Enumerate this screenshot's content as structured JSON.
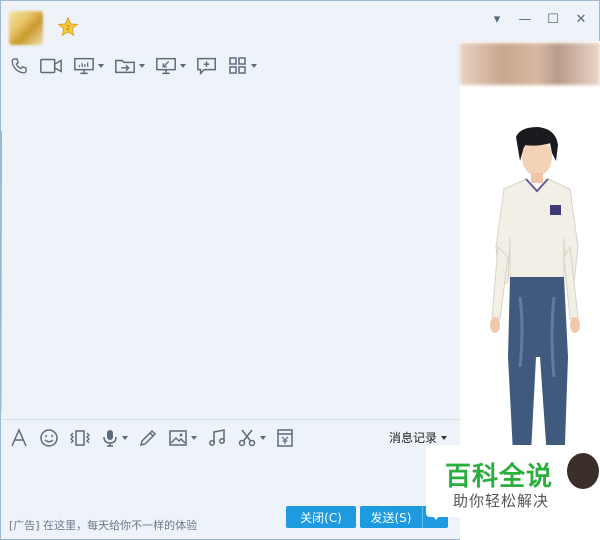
{
  "window": {
    "controls": [
      "▾",
      "—",
      "☐",
      "✕"
    ]
  },
  "top_toolbar": {
    "tools": [
      "phone-icon",
      "video-icon",
      "screen-share-icon",
      "file-transfer-icon",
      "remote-desktop-icon",
      "add-chat-icon",
      "apps-grid-icon"
    ]
  },
  "input_toolbar": {
    "tools": [
      "font-icon",
      "emoji-icon",
      "vibrate-icon",
      "microphone-icon",
      "pen-icon",
      "image-icon",
      "music-icon",
      "scissors-icon",
      "red-envelope-icon"
    ],
    "history_label": "消息记录"
  },
  "footer": {
    "ad_text": "[广告] 在这里，每天给你不一样的体验",
    "close_label": "关闭(C)",
    "send_label": "发送(S)"
  },
  "watermark": {
    "title": "百科全说",
    "subtitle": "助你轻松解决"
  },
  "colors": {
    "accent": "#1e9ae0",
    "window_bg": "#eef3f9",
    "watermark_green": "#2cae3f"
  }
}
